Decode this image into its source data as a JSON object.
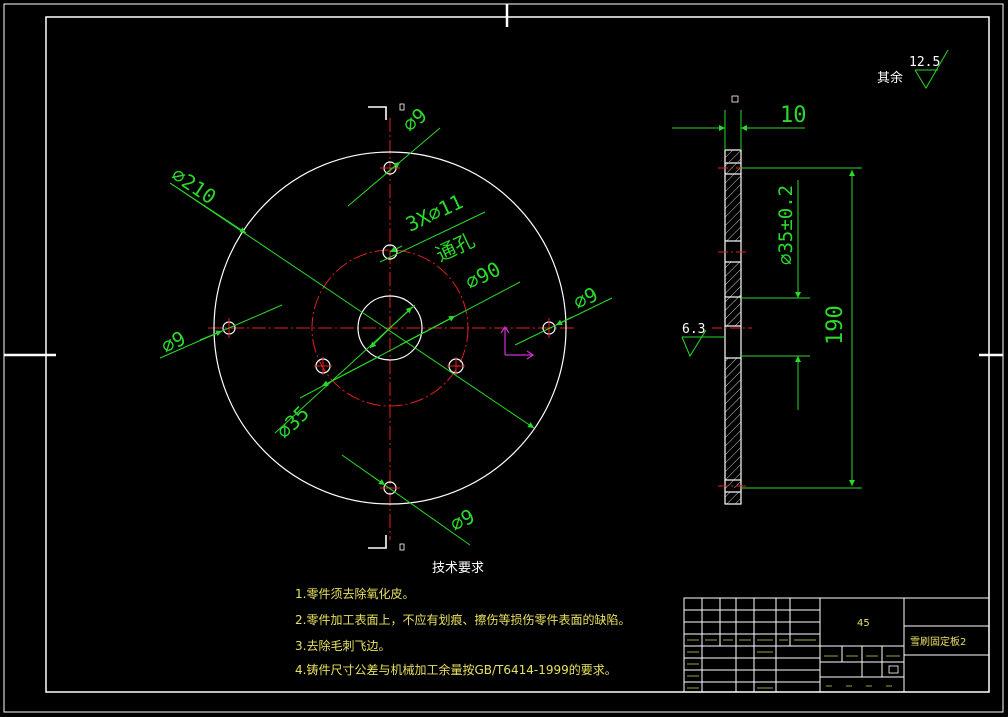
{
  "dimensions": {
    "d9_top": "⌀9",
    "d210": "⌀210",
    "holes": "3X⌀11",
    "through": "通孔",
    "d90": "⌀90",
    "d9_right": "⌀9",
    "d9_left": "⌀9",
    "d35": "⌀35",
    "d9_bottom": "⌀9",
    "thickness": "10",
    "d35_tol": "⌀35±0.2",
    "h190": "190",
    "rough_local": "6.3",
    "rough_rest_value": "12.5",
    "rough_rest_label": "其余"
  },
  "tech_requirements": {
    "title": "技术要求",
    "items": [
      "1.零件须去除氧化皮。",
      "2.零件加工表面上，不应有划痕、擦伤等损伤零件表面的缺陷。",
      "3.去除毛刺飞边。",
      "4.铸件尺寸公差与机械加工余量按GB/T6414-1999的要求。"
    ]
  },
  "title_block": {
    "material": "45",
    "part_name": "雪刷固定板2"
  },
  "colors": {
    "background": "#000000",
    "geometry": "#ffffff",
    "dimension": "#2bd92b",
    "centerline": "#e02020",
    "ucs": "#d030d0"
  }
}
